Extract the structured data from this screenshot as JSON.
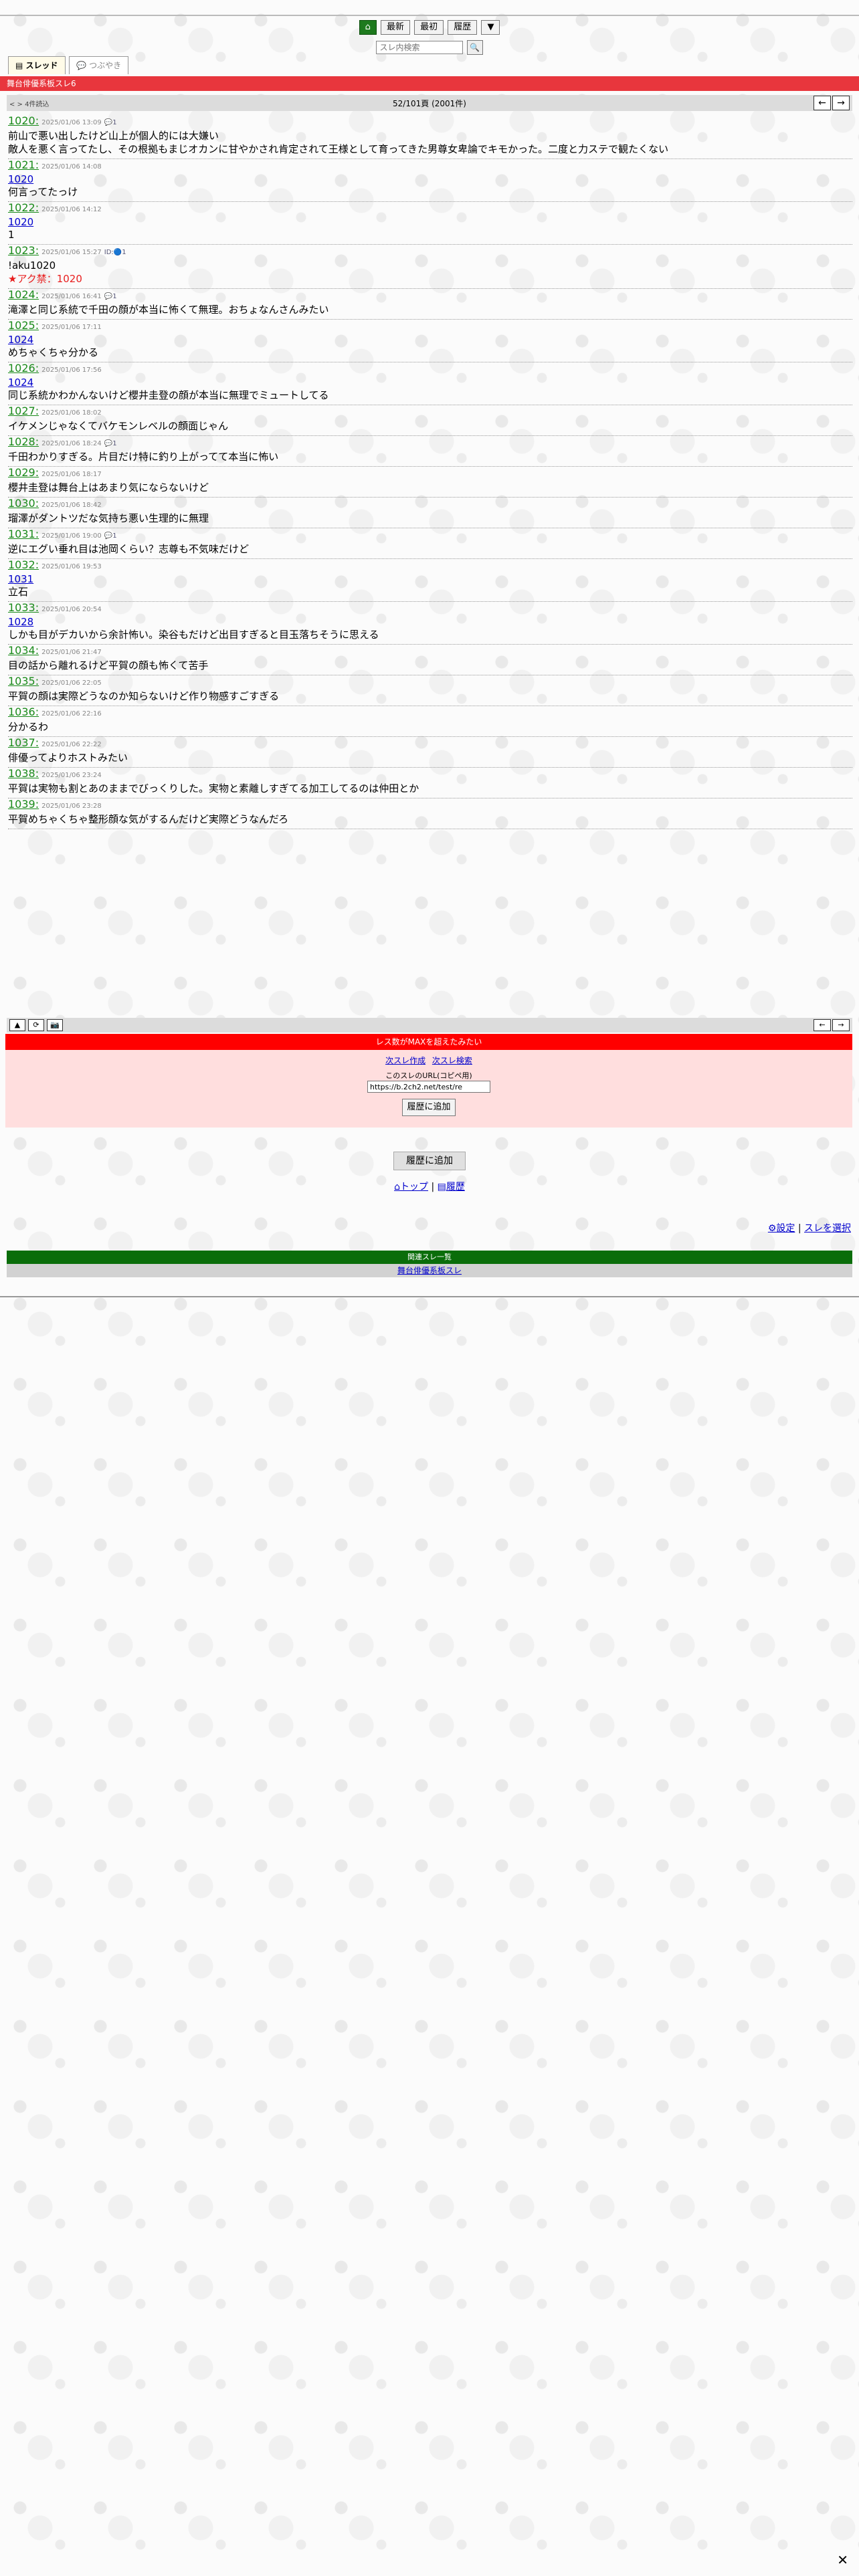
{
  "nav": {
    "home_icon": "home-icon",
    "btn_first": "最新",
    "btn_latest": "最初",
    "btn_history": "履歴",
    "btn_more": "▼"
  },
  "search": {
    "placeholder": "スレ内検索"
  },
  "tabs": {
    "thread": "スレッド",
    "tsubuyaki": "つぶやき"
  },
  "thread_title": "舞台俳優系板スレ6",
  "countbar": {
    "left": "< > 4件読込",
    "center": "52/101頁 (2001件)"
  },
  "posts": [
    {
      "num": "1020:",
      "date": "2025/01/06 13:09",
      "icon": "💬1",
      "anchor": "",
      "body": "前山で悪い出したけど山上が個人的には大嫌い",
      "body2": "敵人を悪く言ってたし、その根拠もまじオカンに甘やかされ肯定されて王様として育ってきた男尊女卑論でキモかった。二度と力ステで観たくない"
    },
    {
      "num": "1021:",
      "date": "2025/01/06 14:08",
      "icon": "",
      "anchor": "1020",
      "body": "何言ってたっけ",
      "body2": ""
    },
    {
      "num": "1022:",
      "date": "2025/01/06 14:12",
      "icon": "",
      "anchor": "1020",
      "body": "1",
      "body2": ""
    },
    {
      "num": "1023:",
      "date": "2025/01/06 15:27",
      "icon": "ID:🔵1",
      "anchor": "",
      "body": "!aku1020",
      "body2": "★アク禁：1020"
    },
    {
      "num": "1024:",
      "date": "2025/01/06 16:41",
      "icon": "💬1",
      "anchor": "",
      "body": "滝澤と同じ系統で千田の顔が本当に怖くて無理。おちょなんさんみたい",
      "body2": ""
    },
    {
      "num": "1025:",
      "date": "2025/01/06 17:11",
      "icon": "",
      "anchor": "1024",
      "body": "めちゃくちゃ分かる",
      "body2": ""
    },
    {
      "num": "1026:",
      "date": "2025/01/06 17:56",
      "icon": "",
      "anchor": "1024",
      "body": "同じ系統かわかんないけど櫻井圭登の顔が本当に無理でミュートしてる",
      "body2": ""
    },
    {
      "num": "1027:",
      "date": "2025/01/06 18:02",
      "icon": "",
      "anchor": "",
      "body": "イケメンじゃなくてバケモンレベルの顔面じゃん",
      "body2": ""
    },
    {
      "num": "1028:",
      "date": "2025/01/06 18:24",
      "icon": "💬1",
      "anchor": "",
      "body": "千田わかりすぎる。片目だけ特に釣り上がってて本当に怖い",
      "body2": ""
    },
    {
      "num": "1029:",
      "date": "2025/01/06 18:17",
      "icon": "",
      "anchor": "",
      "body": "櫻井圭登は舞台上はあまり気にならないけど",
      "body2": ""
    },
    {
      "num": "1030:",
      "date": "2025/01/06 18:42",
      "icon": "",
      "anchor": "",
      "body": "瑠澤がダントツだな気持ち悪い生理的に無理",
      "body2": ""
    },
    {
      "num": "1031:",
      "date": "2025/01/06 19:00",
      "icon": "💬1",
      "anchor": "",
      "body": "逆にエグい垂れ目は池岡くらい？志尊も不気味だけど",
      "body2": ""
    },
    {
      "num": "1032:",
      "date": "2025/01/06 19:53",
      "icon": "",
      "anchor": "1031",
      "body": "立石",
      "body2": ""
    },
    {
      "num": "1033:",
      "date": "2025/01/06 20:54",
      "icon": "",
      "anchor": "1028",
      "body": "しかも目がデカいから余計怖い。染谷もだけど出目すぎると目玉落ちそうに思える",
      "body2": ""
    },
    {
      "num": "1034:",
      "date": "2025/01/06 21:47",
      "icon": "",
      "anchor": "",
      "body": "目の話から離れるけど平賀の顔も怖くて苦手",
      "body2": ""
    },
    {
      "num": "1035:",
      "date": "2025/01/06 22:05",
      "icon": "",
      "anchor": "",
      "body": "平賀の顔は実際どうなのか知らないけど作り物感すごすぎる",
      "body2": ""
    },
    {
      "num": "1036:",
      "date": "2025/01/06 22:16",
      "icon": "",
      "anchor": "",
      "body": "分かるわ",
      "body2": ""
    },
    {
      "num": "1037:",
      "date": "2025/01/06 22:22",
      "icon": "",
      "anchor": "",
      "body": "俳優ってよりホストみたい",
      "body2": ""
    },
    {
      "num": "1038:",
      "date": "2025/01/06 23:24",
      "icon": "",
      "anchor": "",
      "body": "平賀は実物も割とあのままでびっくりした。実物と素離しすぎてる加工してるのは仲田とか",
      "body2": ""
    },
    {
      "num": "1039:",
      "date": "2025/01/06 23:28",
      "icon": "",
      "anchor": "",
      "body": "平賀めちゃくちゃ整形顔な気がするんだけど実際どうなんだろ",
      "body2": ""
    }
  ],
  "bottombar": {
    "up": "▲",
    "reload": "⟳",
    "camera": "📷"
  },
  "maxres": {
    "banner": "レス数がMAXを超えたみたい",
    "link_new": "次スレ作成",
    "link_search": "次スレ検索",
    "url_label": "このスレのURL(コピペ用)",
    "url_value": "https://b.2ch2.net/test/re",
    "add_history": "履歴に追加"
  },
  "add_history2": "履歴に追加",
  "footer_links": {
    "top": "トップ",
    "sep": "|",
    "history": "履歴"
  },
  "settings": {
    "settings": "設定",
    "sep": "|",
    "select_thread": "スレを選択"
  },
  "related": {
    "header": "関連スレ一覧",
    "item": "舞台俳優系板スレ"
  },
  "close": "✕"
}
